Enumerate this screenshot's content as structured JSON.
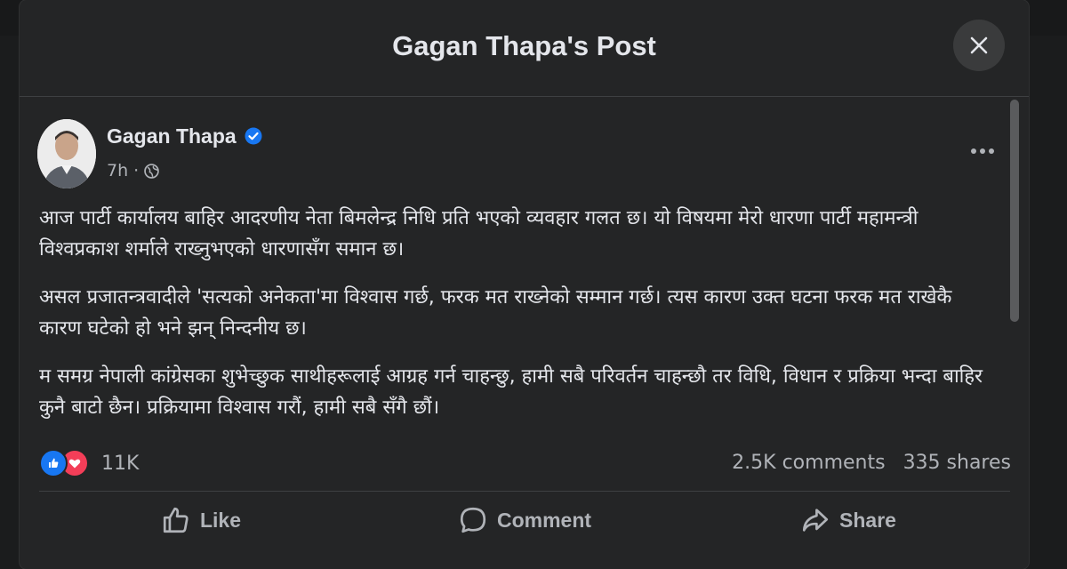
{
  "modal": {
    "title": "Gagan Thapa's Post"
  },
  "post": {
    "author": "Gagan Thapa",
    "time": "7h",
    "separator": "·",
    "paragraphs": [
      "आज पार्टी कार्यालय बाहिर आदरणीय नेता बिमलेन्द्र निधि प्रति भएको व्यवहार गलत छ। यो विषयमा मेरो धारणा पार्टी महामन्त्री विश्वप्रकाश शर्माले राख्नुभएको धारणासँग समान छ।",
      "असल प्रजातन्त्रवादीले 'सत्यको अनेकता'मा विश्वास गर्छ, फरक मत राख्नेको सम्मान गर्छ। त्यस कारण उक्त घटना फरक मत राखेकै कारण घटेको हो भने झन् निन्दनीय छ।",
      "म समग्र नेपाली कांग्रेसका शुभेच्छुक साथीहरूलाई आग्रह गर्न चाहन्छु, हामी सबै परिवर्तन चाहन्छौ तर विधि, विधान र प्रक्रिया भन्दा बाहिर कुनै बाटो छैन। प्रक्रियामा विश्वास गरौं, हामी सबै सँगै छौं।"
    ]
  },
  "engagement": {
    "reactions_count": "11K",
    "comments": "2.5K comments",
    "shares": "335 shares"
  },
  "actions": {
    "like": "Like",
    "comment": "Comment",
    "share": "Share"
  },
  "colors": {
    "background": "#242526",
    "accent": "#1877f2",
    "love": "#f33e58",
    "muted": "#b0b3b8"
  }
}
